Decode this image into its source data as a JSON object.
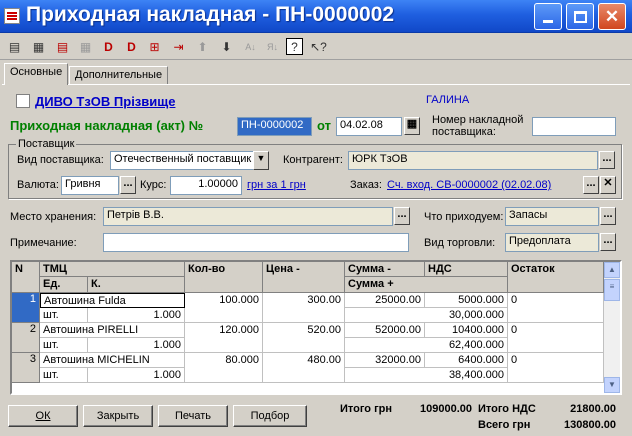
{
  "window": {
    "title": "Приходная накладная - ПН-0000002",
    "minimize_icon": "minimize-icon",
    "maximize_icon": "maximize-icon",
    "close_icon": "close-icon"
  },
  "toolbar": {
    "icons": [
      "new-row-icon",
      "copy-row-icon",
      "delete-row-icon",
      "edit-row-icon",
      "mark-delete-icon",
      "unmark-delete-icon",
      "insert-icon",
      "move-icon",
      "up-arrow-icon",
      "down-arrow-icon",
      "sort-asc-icon",
      "sort-desc-icon",
      "help-icon",
      "pointer-help-icon"
    ]
  },
  "tabs": [
    {
      "label": "Основные",
      "active": true
    },
    {
      "label": "Дополнительные",
      "active": false
    }
  ],
  "header": {
    "company_link": "ДИВО ТзОВ Прізвище",
    "user": "ГАЛИНА",
    "doc_title": "Приходная накладная (акт) №",
    "doc_number": "ПН-0000002",
    "from_label": "от",
    "date": "04.02.08",
    "supplier_invoice_label_1": "Номер накладной",
    "supplier_invoice_label_2": "поставщика:",
    "supplier_invoice_value": ""
  },
  "supplier": {
    "group_label": "Поставщик",
    "type_label": "Вид поставщика:",
    "type_value": "Отечественный поставщик",
    "counterparty_label": "Контрагент:",
    "counterparty_value": "ЮРК ТзОВ",
    "currency_label": "Валюта:",
    "currency_value": "Гривня",
    "rate_label": "Курс:",
    "rate_value": "1.00000",
    "rate_link": "грн за 1 грн",
    "order_label": "Заказ:",
    "order_link": "Сч. вход. СВ-0000002 (02.02.08)"
  },
  "storage": {
    "label": "Место хранения:",
    "value": "Петрів В.В.",
    "what_label": "Что приходуем:",
    "what_value": "Запасы"
  },
  "note": {
    "label": "Примечание:",
    "value": "",
    "trade_label": "Вид торговли:",
    "trade_value": "Предоплата"
  },
  "grid": {
    "headers": {
      "n": "N",
      "tmc": "ТМЦ",
      "unit": "Ед.",
      "k": "К.",
      "qty": "Кол-во",
      "price": "Цена -",
      "sum": "Сумма -",
      "vat": "НДС",
      "sum_plus": "Сумма +",
      "rest": "Остаток"
    },
    "rows": [
      {
        "n": "1",
        "name": "Автошина Fulda",
        "unit": "шт.",
        "k": "1.000",
        "qty": "100.000",
        "price": "300.00",
        "sum": "25000.00",
        "vat": "5000.000",
        "sum_plus": "30,000.000",
        "rest": "0"
      },
      {
        "n": "2",
        "name": "Автошина PIRELLI",
        "unit": "шт.",
        "k": "1.000",
        "qty": "120.000",
        "price": "520.00",
        "sum": "52000.00",
        "vat": "10400.000",
        "sum_plus": "62,400.000",
        "rest": "0"
      },
      {
        "n": "3",
        "name": "Автошина MICHELIN",
        "unit": "шт.",
        "k": "1.000",
        "qty": "80.000",
        "price": "480.00",
        "sum": "32000.00",
        "vat": "6400.000",
        "sum_plus": "38,400.000",
        "rest": "0"
      }
    ]
  },
  "buttons": {
    "ok": "ОК",
    "close": "Закрыть",
    "print": "Печать",
    "select": "Подбор"
  },
  "totals": {
    "total_label": "Итого грн",
    "total_value": "109000.00",
    "vat_label": "Итого НДС",
    "vat_value": "21800.00",
    "grand_label": "Всего грн",
    "grand_value": "130800.00"
  }
}
